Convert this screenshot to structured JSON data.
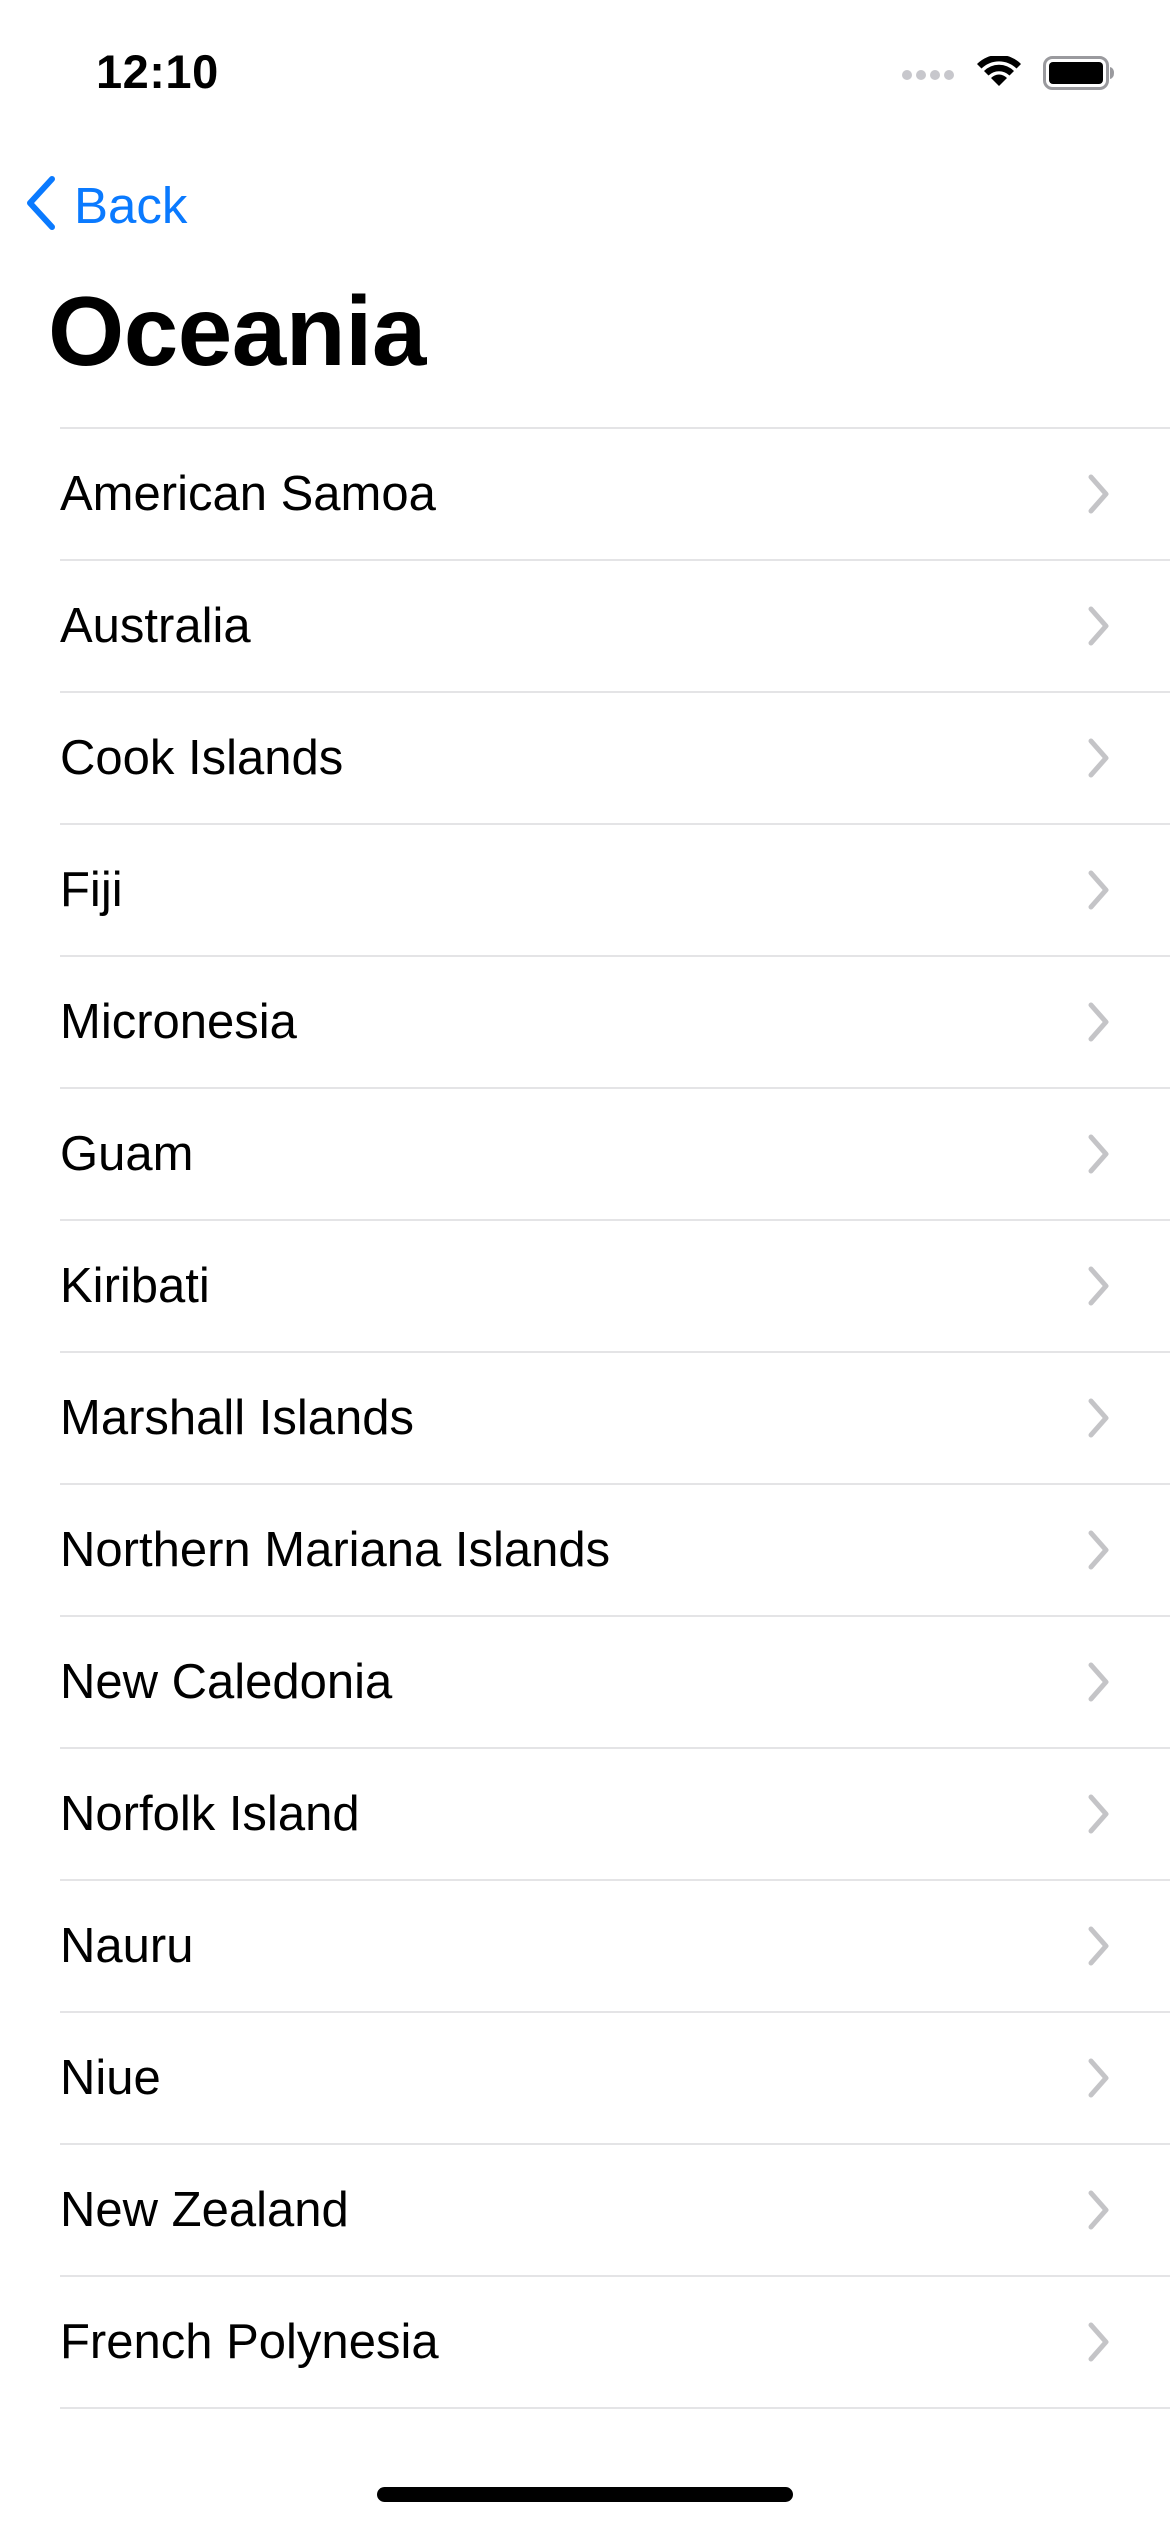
{
  "status_bar": {
    "time": "12:10",
    "signal_icon": "cellular-signal-icon",
    "wifi_icon": "wifi-icon",
    "battery_icon": "battery-icon"
  },
  "nav": {
    "back_label": "Back",
    "back_icon": "chevron-left-icon",
    "title": "Oceania"
  },
  "colors": {
    "accent": "#0a7aff",
    "separator": "#e4e4e6",
    "chevron": "#c4c4c7"
  },
  "countries": [
    {
      "label": "American Samoa"
    },
    {
      "label": "Australia"
    },
    {
      "label": "Cook Islands"
    },
    {
      "label": "Fiji"
    },
    {
      "label": "Micronesia"
    },
    {
      "label": "Guam"
    },
    {
      "label": "Kiribati"
    },
    {
      "label": "Marshall Islands"
    },
    {
      "label": "Northern Mariana Islands"
    },
    {
      "label": "New Caledonia"
    },
    {
      "label": "Norfolk Island"
    },
    {
      "label": "Nauru"
    },
    {
      "label": "Niue"
    },
    {
      "label": "New Zealand"
    },
    {
      "label": "French Polynesia"
    }
  ]
}
